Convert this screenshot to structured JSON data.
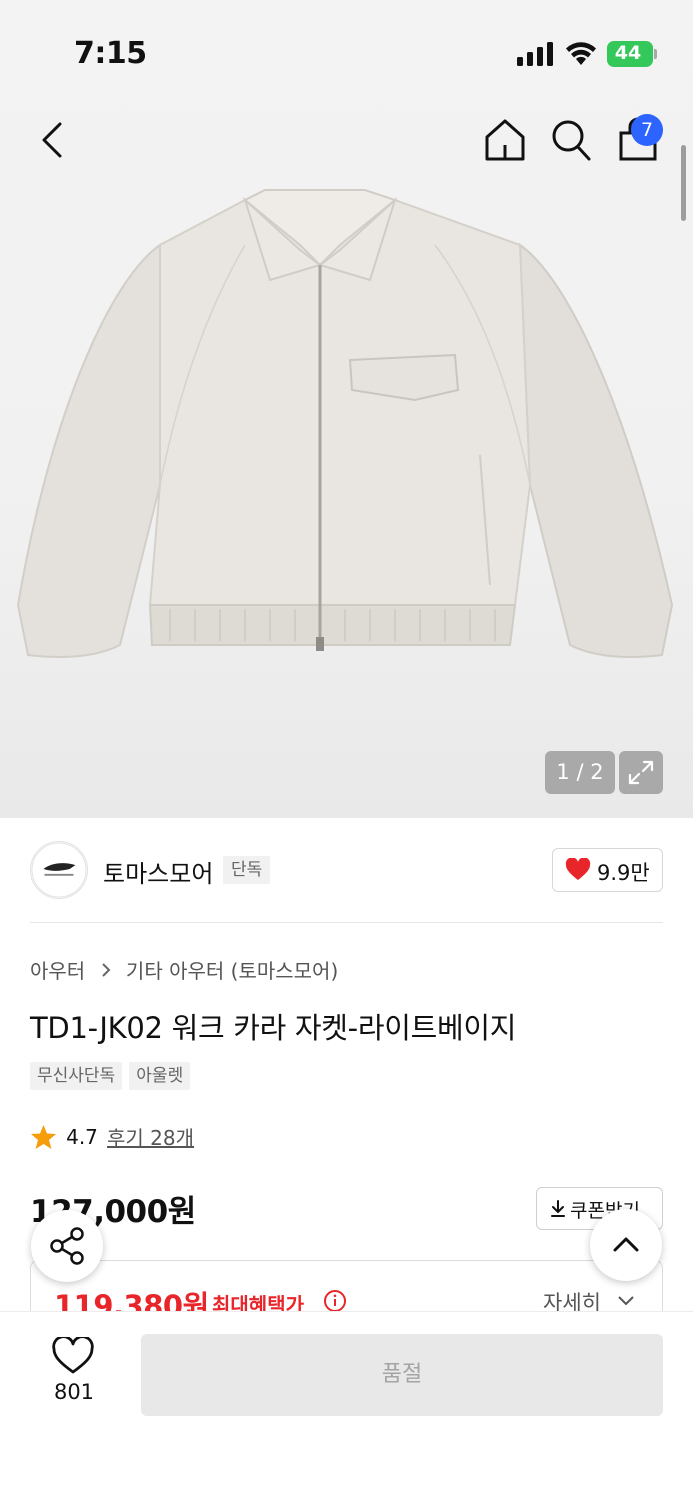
{
  "status_bar": {
    "time": "7:15",
    "battery": "44"
  },
  "header": {
    "back_icon": "chevron-left-icon",
    "home_icon": "home-icon",
    "search_icon": "search-icon",
    "bag_icon": "shopping-bag-icon",
    "bag_badge": "7",
    "badge_color": "#2d63ff"
  },
  "gallery": {
    "counter": "1 / 2",
    "expand_icon": "expand-icon"
  },
  "brand": {
    "name": "토마스모어",
    "tag": "단독",
    "likes": "9.9만",
    "heart_color": "#e8262a"
  },
  "breadcrumb": {
    "level1": "아우터",
    "level2": "기타 아우터 (토마스모어)"
  },
  "product": {
    "title": "TD1-JK02 워크 카라 자켓-라이트베이지",
    "tags": [
      "무신사단독",
      "아울렛"
    ],
    "rating": "4.7",
    "review_link": "후기 28개",
    "price": "127,000원",
    "coupon_label": "쿠폰받기"
  },
  "benefit": {
    "price": "119,380원",
    "label": "최대혜택가",
    "detail": "자세히",
    "accent_color": "#e8262a"
  },
  "floating": {
    "share_icon": "share-icon",
    "top_icon": "chevron-up-icon"
  },
  "bottom_bar": {
    "wish_count": "801",
    "soldout_label": "품절"
  }
}
